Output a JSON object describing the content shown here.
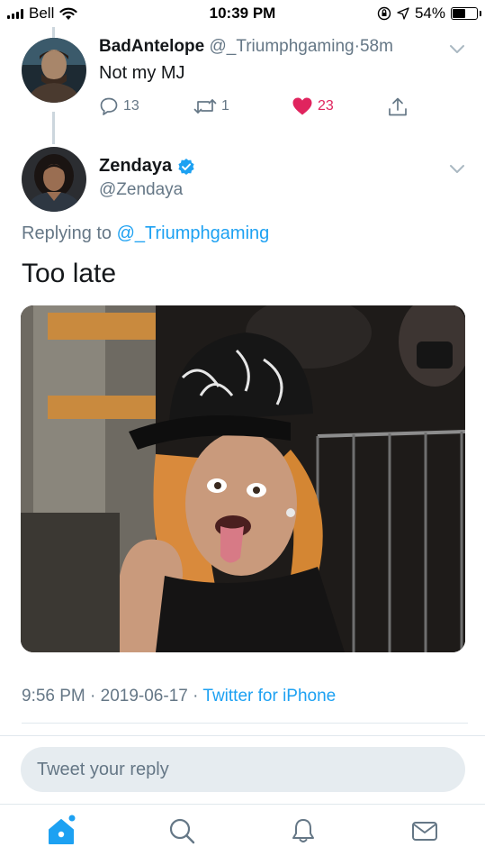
{
  "status_bar": {
    "carrier": "Bell",
    "time": "10:39 PM",
    "battery_percent": "54%",
    "battery_level": 0.54,
    "icons": [
      "signal-icon",
      "wifi-icon",
      "orientation-lock-icon",
      "location-icon",
      "battery-icon"
    ]
  },
  "parent_tweet": {
    "display_name": "BadAntelope",
    "handle": "@_Triumphgaming",
    "separator": "·",
    "time_ago": "58m",
    "text": "Not my MJ",
    "reply_count": "13",
    "retweet_count": "1",
    "like_count": "23",
    "liked": true
  },
  "main_tweet": {
    "display_name": "Zendaya",
    "verified": true,
    "handle": "@Zendaya",
    "replying_prefix": "Replying to",
    "replying_to": "@_Triumphgaming",
    "text": "Too late",
    "media_description_icon": "photo-media",
    "timestamp": "9:56 PM · 2019-06-17 ·",
    "source": "Twitter for iPhone"
  },
  "reply_box": {
    "placeholder": "Tweet your reply"
  },
  "tab_bar": {
    "tabs": [
      "home-icon",
      "search-icon",
      "notifications-icon",
      "messages-icon"
    ]
  },
  "colors": {
    "accent": "#1da1f2",
    "like": "#e0245e",
    "muted": "#657786",
    "text": "#14171a",
    "divider": "#e1e8ed",
    "reply_box_bg": "#e6ecf0"
  }
}
